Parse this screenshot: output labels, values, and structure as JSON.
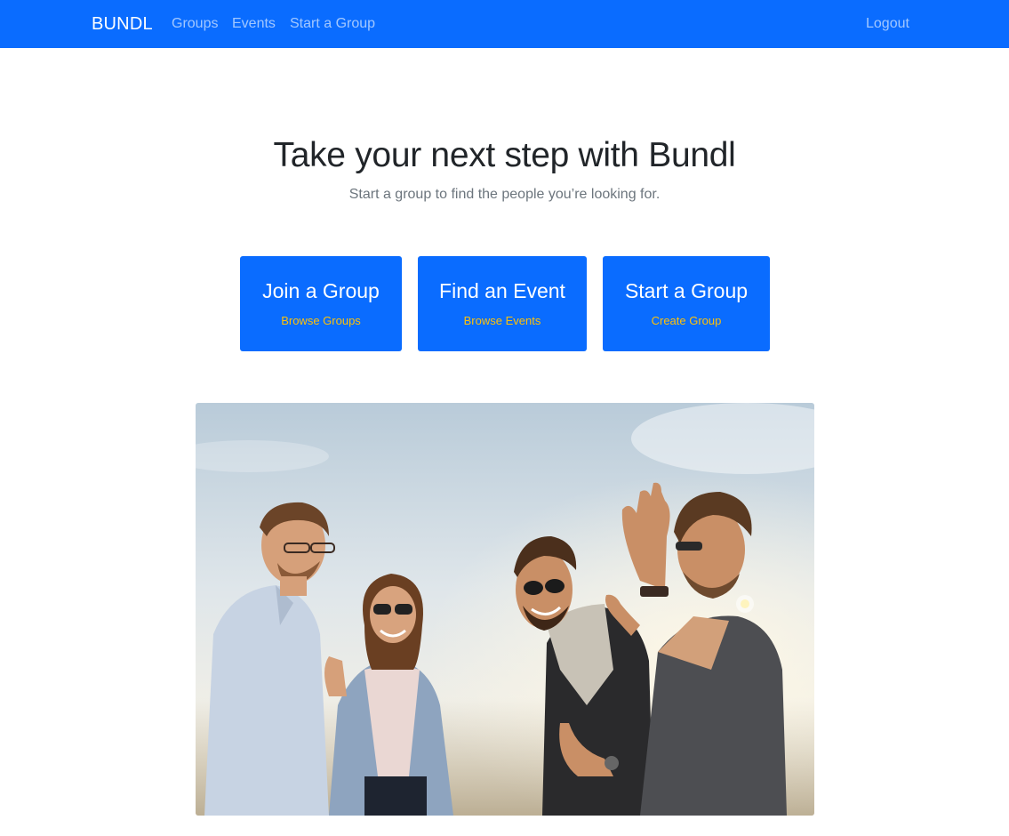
{
  "nav": {
    "brand": "BUNDL",
    "links": [
      {
        "label": "Groups"
      },
      {
        "label": "Events"
      },
      {
        "label": "Start a Group"
      }
    ],
    "logout": "Logout"
  },
  "hero": {
    "title": "Take your next step with Bundl",
    "subtitle": "Start a group to find the people you’re looking for."
  },
  "cards": [
    {
      "title": "Join a Group",
      "link": "Browse Groups"
    },
    {
      "title": "Find an Event",
      "link": "Browse Events"
    },
    {
      "title": "Start a Group",
      "link": "Create Group"
    }
  ],
  "colors": {
    "brand_blue": "#0a6cff",
    "link_accent": "#ffc107",
    "heading": "#212529",
    "muted": "#6c757d"
  }
}
